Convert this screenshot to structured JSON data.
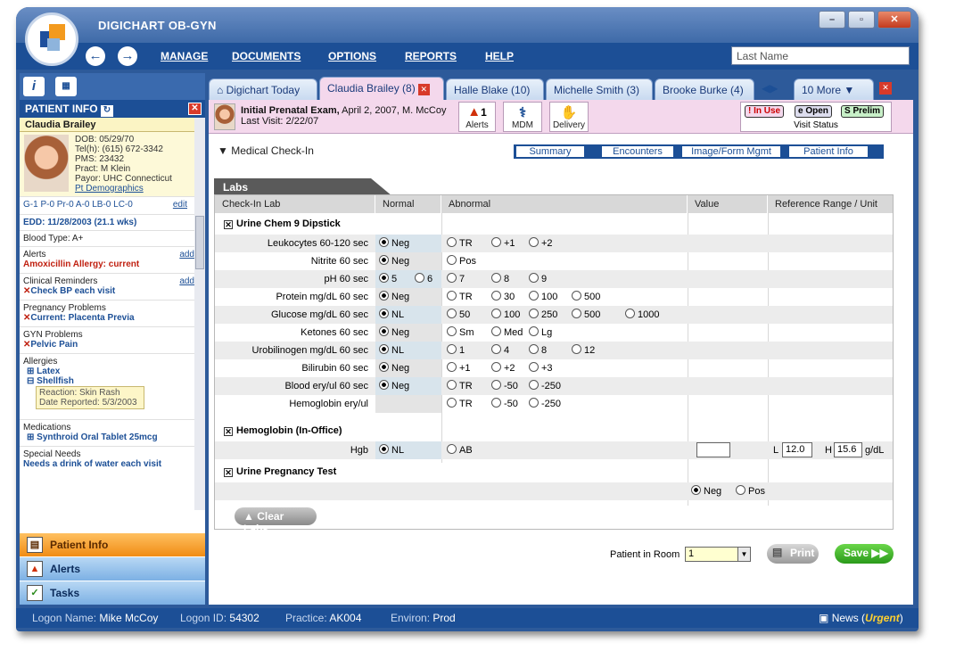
{
  "app": {
    "title": "DIGICHART OB-GYN"
  },
  "menu": {
    "manage": "MANAGE",
    "documents": "DOCUMENTS",
    "options": "OPTIONS",
    "reports": "REPORTS",
    "help": "HELP"
  },
  "search": {
    "placeholder": "Last Name"
  },
  "patient_info": {
    "header": "PATIENT INFO",
    "name": "Claudia Brailey",
    "dob": "DOB:  05/29/70",
    "tel": "Tel(h): (615) 672-3342",
    "pms": "PMS:  23432",
    "pract": "Pract:  M Klein",
    "payor": "Payor: UHC Connecticut",
    "demographics_link": "Pt Demographics",
    "gp": "G-1  P-0  Pr-0  A-0  LB-0  LC-0",
    "gp_edit": "edit",
    "edd": "EDD: 11/28/2003  (21.1 wks)",
    "blood_type": "Blood Type: A+",
    "alerts_label": "Alerts",
    "alerts_add": "add",
    "alerts_value": "Amoxicillin Allergy: current",
    "reminders_label": "Clinical Reminders",
    "reminders_add": "add",
    "reminders_value": "Check BP each visit",
    "preg_label": "Pregnancy Problems",
    "preg_value": "Current: Placenta Previa",
    "gyn_label": "GYN Problems",
    "gyn_value": "Pelvic Pain",
    "allergies_label": "Allergies",
    "allergy1": "Latex",
    "allergy2": "Shellfish",
    "reaction": "Reaction: Skin Rash",
    "date_reported": "Date Reported: 5/3/2003",
    "meds_label": "Medications",
    "meds_value": "Synthroid Oral Tablet 25mcg",
    "needs_label": "Special Needs",
    "needs_value": "Needs a drink of water each visit"
  },
  "left_nav": {
    "patient_info": "Patient Info",
    "alerts": "Alerts",
    "tasks": "Tasks"
  },
  "tabs": [
    {
      "label": "Digichart Today"
    },
    {
      "label": "Claudia Brailey (8)"
    },
    {
      "label": "Halle Blake (10)"
    },
    {
      "label": "Michelle Smith (3)"
    },
    {
      "label": "Brooke Burke (4)"
    },
    {
      "label": "10 More"
    }
  ],
  "visit": {
    "title": "Initial Prenatal Exam,",
    "details": " April 2, 2007, M. McCoy",
    "last_visit": "Last Visit:  2/22/07",
    "alerts_count": "1",
    "alerts": "Alerts",
    "mdm": "MDM",
    "delivery": "Delivery",
    "in_use": "In Use",
    "open": "Open",
    "prelim": "Prelim",
    "visit_status": "Visit Status"
  },
  "section": {
    "title": "Medical Check-In",
    "subtabs": [
      "Summary",
      "Encounters",
      "Image/Form Mgmt",
      "Patient Info"
    ]
  },
  "labs": {
    "header": "Labs",
    "cols": [
      "Check-In Lab",
      "Normal",
      "Abnormal",
      "Value",
      "Reference Range / Unit"
    ],
    "group1": "Urine Chem 9 Dipstick",
    "rows": [
      {
        "label": "Leukocytes 60-120 sec",
        "normal": [
          "Neg"
        ],
        "abnormal": [
          "TR",
          "+1",
          "+2"
        ]
      },
      {
        "label": "Nitrite 60 sec",
        "normal": [
          "Neg"
        ],
        "abnormal": [
          "Pos"
        ]
      },
      {
        "label": "pH 60 sec",
        "normal": [
          "5",
          "6"
        ],
        "abnormal": [
          "7",
          "8",
          "9"
        ]
      },
      {
        "label": "Protein mg/dL 60 sec",
        "normal": [
          "Neg"
        ],
        "abnormal": [
          "TR",
          "30",
          "100",
          "500"
        ]
      },
      {
        "label": "Glucose mg/dL 60 sec",
        "normal": [
          "NL"
        ],
        "abnormal": [
          "50",
          "100",
          "250",
          "500",
          "1000"
        ]
      },
      {
        "label": "Ketones 60 sec",
        "normal": [
          "Neg"
        ],
        "abnormal": [
          "Sm",
          "Med",
          "Lg"
        ]
      },
      {
        "label": "Urobilinogen mg/dL 60 sec",
        "normal": [
          "NL"
        ],
        "abnormal": [
          "1",
          "4",
          "8",
          "12"
        ]
      },
      {
        "label": "Bilirubin 60 sec",
        "normal": [
          "Neg"
        ],
        "abnormal": [
          "+1",
          "+2",
          "+3"
        ]
      },
      {
        "label": "Blood ery/ul 60 sec",
        "normal": [
          "Neg"
        ],
        "abnormal": [
          "TR",
          "-50",
          "-250"
        ]
      },
      {
        "label": "Hemoglobin ery/ul",
        "normal": [],
        "abnormal": [
          "TR",
          "-50",
          "-250"
        ]
      }
    ],
    "group2": "Hemoglobin (In-Office)",
    "hgb_label": "Hgb",
    "hgb_normal": "NL",
    "hgb_abnormal": "AB",
    "ref_l": "L",
    "ref_l_val": "12.0",
    "ref_h": "H",
    "ref_h_val": "15.6",
    "ref_unit": "g/dL",
    "group3": "Urine Pregnancy Test",
    "preg_neg": "Neg",
    "preg_pos": "Pos",
    "clear": "Clear Labs"
  },
  "footer": {
    "room_label": "Patient in Room",
    "room_value": "1",
    "print": "Print",
    "save": "Save"
  },
  "status": {
    "logon_label": "Logon Name:",
    "logon": "Mike McCoy",
    "id_label": "Logon ID:",
    "id": "54302",
    "practice_label": "Practice:",
    "practice": "AK004",
    "environ_label": "Environ:",
    "environ": "Prod",
    "news": "News (",
    "urgent": "Urgent",
    ")": ")"
  }
}
